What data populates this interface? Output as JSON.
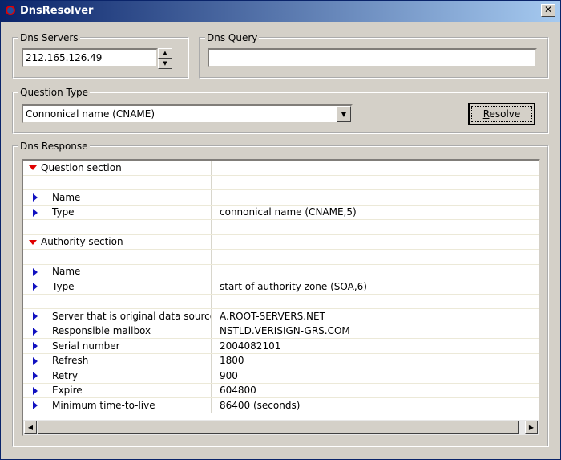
{
  "window": {
    "title": "DnsResolver",
    "close_label": "✕"
  },
  "dns_servers": {
    "legend": "Dns Servers",
    "value": "212.165.126.49"
  },
  "dns_query": {
    "legend": "Dns Query",
    "value": ""
  },
  "question_type": {
    "legend": "Question Type",
    "selected": "Connonical name (CNAME)"
  },
  "resolve_button": {
    "label": "Resolve"
  },
  "dns_response": {
    "legend": "Dns Response",
    "rows": [
      {
        "kind": "section",
        "label": "Question section",
        "value": ""
      },
      {
        "kind": "blank",
        "label": "",
        "value": ""
      },
      {
        "kind": "item",
        "label": "Name",
        "value": ""
      },
      {
        "kind": "item",
        "label": "Type",
        "value": "connonical name  (CNAME,5)"
      },
      {
        "kind": "blank",
        "label": "",
        "value": ""
      },
      {
        "kind": "section",
        "label": "Authority section",
        "value": ""
      },
      {
        "kind": "blank",
        "label": "",
        "value": ""
      },
      {
        "kind": "item",
        "label": "Name",
        "value": ""
      },
      {
        "kind": "item",
        "label": "Type",
        "value": "start of authority zone  (SOA,6)"
      },
      {
        "kind": "blank",
        "label": "",
        "value": ""
      },
      {
        "kind": "item",
        "label": "Server that is original data source",
        "value": "A.ROOT-SERVERS.NET"
      },
      {
        "kind": "item",
        "label": "Responsible mailbox",
        "value": "NSTLD.VERISIGN-GRS.COM"
      },
      {
        "kind": "item",
        "label": "Serial number",
        "value": "2004082101"
      },
      {
        "kind": "item",
        "label": "Refresh",
        "value": "1800"
      },
      {
        "kind": "item",
        "label": "Retry",
        "value": "900"
      },
      {
        "kind": "item",
        "label": "Expire",
        "value": "604800"
      },
      {
        "kind": "item",
        "label": "Minimum time-to-live",
        "value": "86400 (seconds)"
      }
    ]
  },
  "icons": {
    "section_marker": "expand-down-triangle-icon",
    "item_marker": "item-right-triangle-icon",
    "spin_up": "▲",
    "spin_down": "▼",
    "dropdown": "▼",
    "scroll_left": "◀",
    "scroll_right": "▶"
  },
  "colors": {
    "title_bar": "#0a246a",
    "section_marker": "#e00000",
    "item_marker": "#1010c0",
    "face": "#d4d0c8"
  }
}
